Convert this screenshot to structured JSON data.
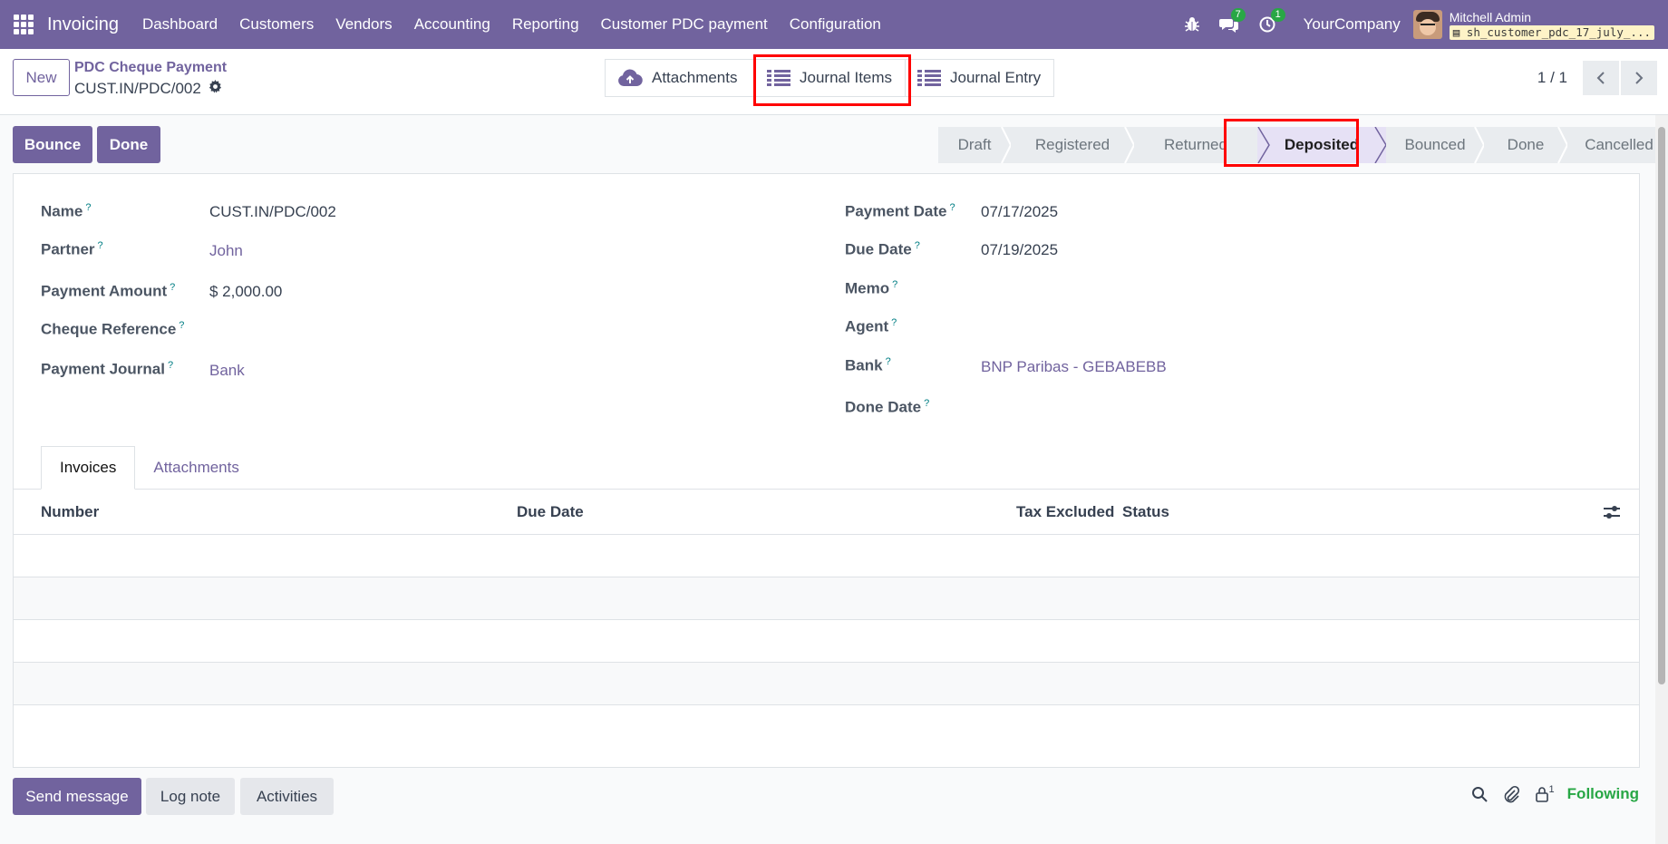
{
  "navbar": {
    "app_name": "Invoicing",
    "menu": [
      "Dashboard",
      "Customers",
      "Vendors",
      "Accounting",
      "Reporting",
      "Customer PDC payment",
      "Configuration"
    ],
    "chat_count": "7",
    "activity_count": "1",
    "company": "YourCompany",
    "user_name": "Mitchell Admin",
    "db_name": "sh_customer_pdc_17_july_..."
  },
  "control": {
    "new_label": "New",
    "breadcrumb_parent": "PDC Cheque Payment",
    "breadcrumb_current": "CUST.IN/PDC/002",
    "smart_buttons": {
      "attachments": "Attachments",
      "journal_items": "Journal Items",
      "journal_entry": "Journal Entry"
    },
    "pager": "1 / 1"
  },
  "actions": {
    "bounce": "Bounce",
    "done": "Done"
  },
  "statusbar": {
    "stages": [
      "Draft",
      "Registered",
      "Returned",
      "Deposited",
      "Bounced",
      "Done",
      "Cancelled"
    ],
    "active": "Deposited"
  },
  "form": {
    "labels": {
      "name": "Name",
      "partner": "Partner",
      "payment_amount": "Payment Amount",
      "cheque_reference": "Cheque Reference",
      "payment_journal": "Payment Journal",
      "payment_date": "Payment Date",
      "due_date": "Due Date",
      "memo": "Memo",
      "agent": "Agent",
      "bank": "Bank",
      "done_date": "Done Date"
    },
    "help_mark": "?",
    "values": {
      "name": "CUST.IN/PDC/002",
      "partner": "John",
      "payment_amount": "$ 2,000.00",
      "cheque_reference": "",
      "payment_journal": "Bank",
      "payment_date": "07/17/2025",
      "due_date": "07/19/2025",
      "memo": "",
      "agent": "",
      "bank": "BNP Paribas - GEBABEBB",
      "done_date": ""
    }
  },
  "tabs": {
    "invoices": "Invoices",
    "attachments": "Attachments"
  },
  "table": {
    "columns": {
      "number": "Number",
      "due_date": "Due Date",
      "tax_excluded": "Tax Excluded",
      "status": "Status"
    }
  },
  "chatter": {
    "send_message": "Send message",
    "log_note": "Log note",
    "activities": "Activities",
    "followers_count": "1",
    "following": "Following"
  },
  "colors": {
    "brand": "#71639e",
    "highlight": "#ff0000",
    "success": "#28a745"
  }
}
